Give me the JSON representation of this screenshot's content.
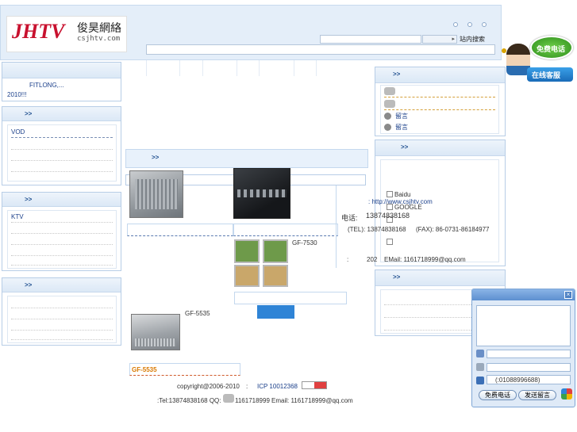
{
  "logo": {
    "brand": "JHTV",
    "name_cn": "俊昊網絡",
    "domain": "csjhtv.com"
  },
  "header": {
    "search_button": "站内搜索",
    "search_value": "",
    "nav_items": [
      "",
      "",
      "",
      "",
      "",
      "",
      ""
    ]
  },
  "left": {
    "notice_text_1": "FITLONG,...",
    "notice_prefix": "",
    "notice_text_2": "2010!!!",
    "panel1_title": ">>",
    "panel1_first": "VOD",
    "panel2_title": ">>",
    "panel2_first": "KTV",
    "panel3_title": ">>"
  },
  "center": {
    "products_title": ">>",
    "product_label_1": "GF-7530",
    "product_label_2": "GF-5535",
    "product_label_3": "GF-5535"
  },
  "right": {
    "panel1_title": ">>",
    "message_1": "留言",
    "message_2": "留言",
    "panel2_title": ">>",
    "search_options": [
      "Baidu",
      "GOOGLE"
    ],
    "panel3_title": ">>"
  },
  "contact": {
    "website": ": http://www.csjhtv.com",
    "phone_label": "电话:",
    "phone": "13874838168",
    "tel_line": "(TEL): 13874838168",
    "fax_line": "(FAX): 86-0731-86184977",
    "address_prefix": ":",
    "room": "202",
    "email_line": "EMail: 1161718999@qq.com"
  },
  "footer": {
    "copyright": "copyright@2006-2010",
    "sep": ":",
    "icp": "ICP 10012368",
    "contact_line": ":Tel:13874838168 QQ:",
    "qq": "1161718999",
    "email": "Email: 1161718999@qq.com"
  },
  "float_badge": {
    "top": "免费电话",
    "bottom": "在线客服"
  },
  "chat_widget": {
    "phone_hint": "(:01088996688)",
    "free_call_button": "免费电话",
    "send_message_button": "发送留言",
    "close": "×"
  }
}
